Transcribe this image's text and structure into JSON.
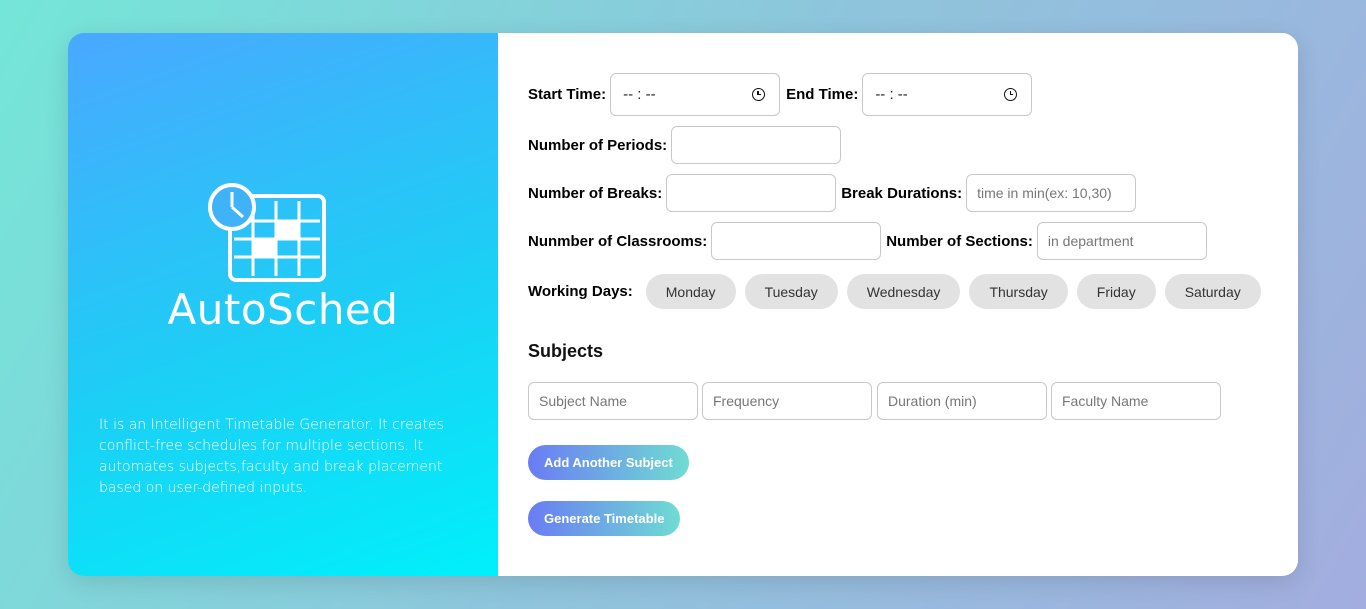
{
  "brand": {
    "name": "AutoSched",
    "description": "It is an Intelligent Timetable Generator. It creates conflict-free schedules for multiple sections. It automates subjects,faculty and break placement based on user-defined inputs."
  },
  "form": {
    "start_time_label": "Start Time:",
    "start_time_value": "-- : --",
    "end_time_label": "End Time:",
    "end_time_value": "-- : --",
    "periods_label": "Number of Periods:",
    "breaks_label": "Number of Breaks:",
    "break_durations_label": "Break Durations:",
    "break_durations_placeholder": "time in min(ex: 10,30)",
    "classrooms_label": "Nunmber of Classrooms:",
    "sections_label": "Number of Sections:",
    "sections_placeholder": "in department",
    "working_days_label": "Working Days:",
    "days": [
      "Monday",
      "Tuesday",
      "Wednesday",
      "Thursday",
      "Friday",
      "Saturday"
    ]
  },
  "subjects": {
    "title": "Subjects",
    "subject_name_placeholder": "Subject Name",
    "frequency_placeholder": "Frequency",
    "duration_placeholder": "Duration (min)",
    "faculty_placeholder": "Faculty Name",
    "add_button": "Add Another Subject",
    "generate_button": "Generate Timetable"
  },
  "icons": [
    "clock-icon",
    "calendar-grid-icon",
    "time-picker-icon"
  ]
}
